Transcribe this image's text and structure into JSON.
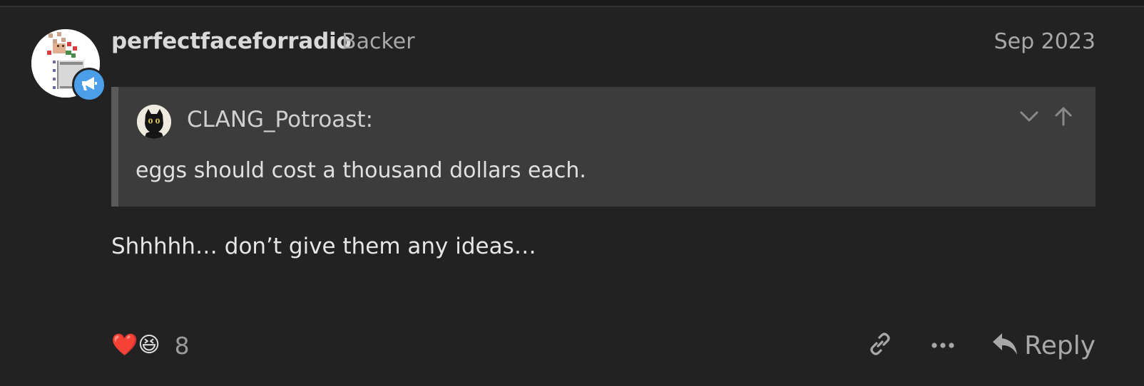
{
  "post": {
    "username": "perfectfaceforradio",
    "user_title": "Backer",
    "date": "Sep 2023",
    "avatar_flair_icon": "megaphone-icon",
    "flair_color": "#4a9fe8",
    "quote": {
      "author": "CLANG_Potroast:",
      "text": "eggs should cost a thousand dollars each.",
      "controls": [
        "chevron-down-icon",
        "arrow-up-icon"
      ]
    },
    "body": "Shhhhh… don’t give them any ideas…",
    "reactions": {
      "emojis": [
        "❤️",
        "😆"
      ],
      "count": "8"
    },
    "actions": {
      "link_icon": "link-icon",
      "more_icon": "ellipsis-icon",
      "reply_icon": "reply-arrow-icon",
      "reply_label": "Reply"
    }
  }
}
